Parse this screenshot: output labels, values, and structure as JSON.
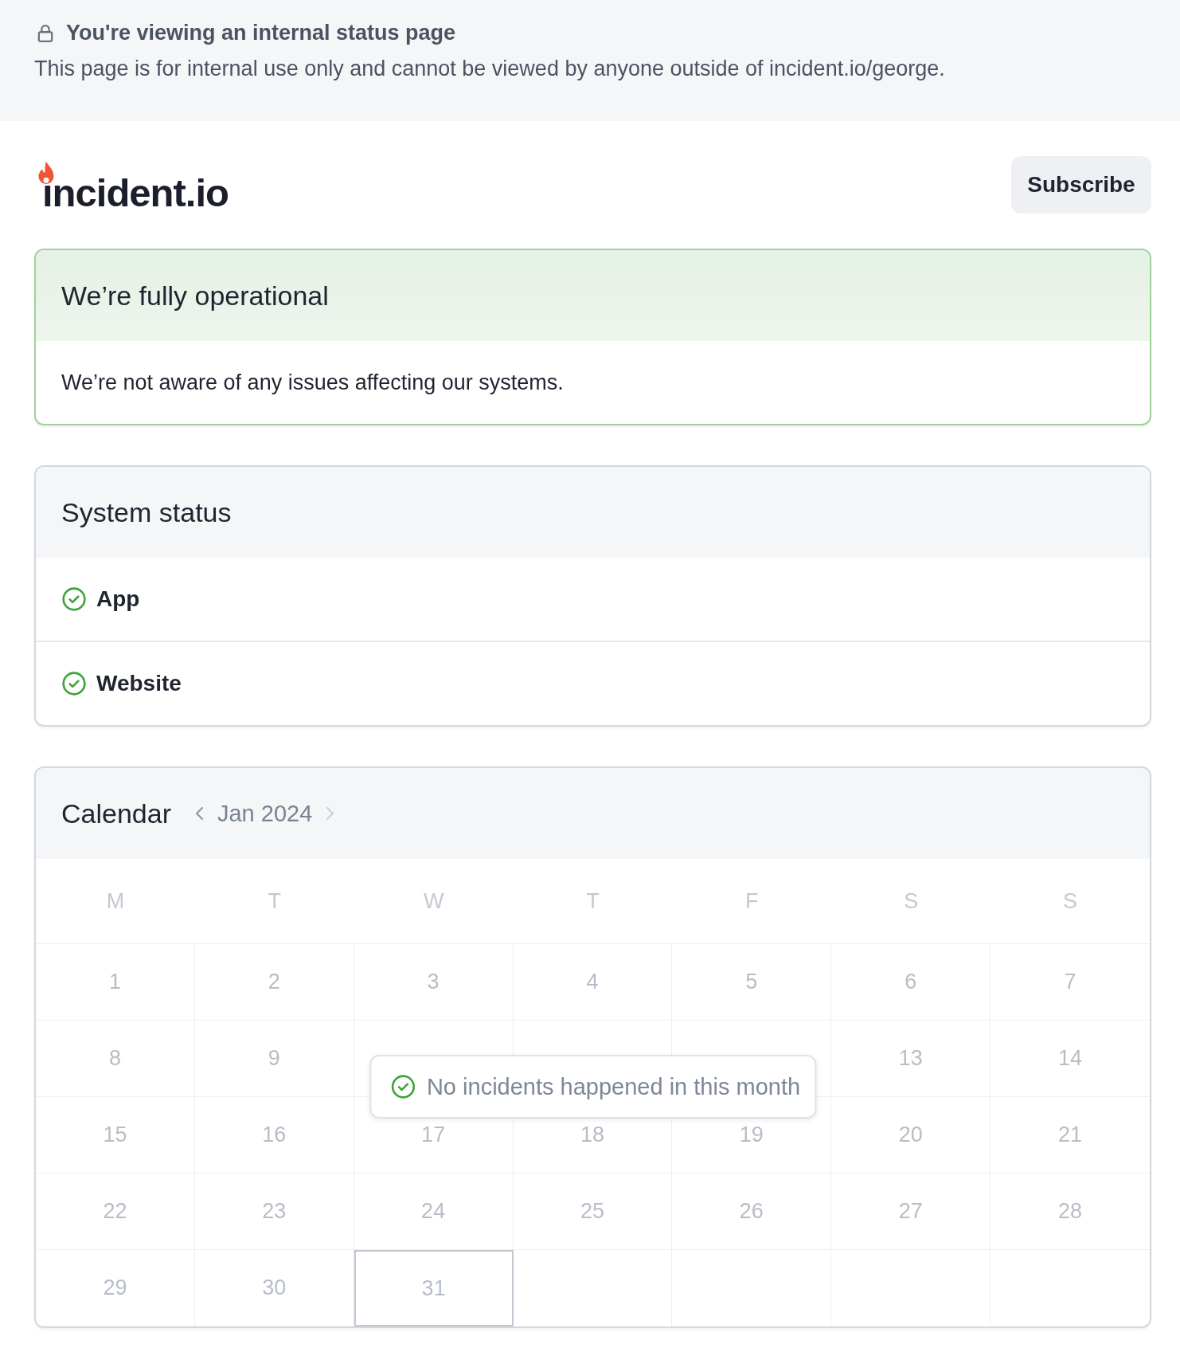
{
  "banner": {
    "title": "You're viewing an internal status page",
    "text": "This page is for internal use only and cannot be viewed by anyone outside of incident.io/george."
  },
  "header": {
    "logo": "incident.io",
    "subscribe_button": "Subscribe"
  },
  "summary": {
    "title": "We’re fully operational",
    "text": "We’re not aware of any issues affecting our systems."
  },
  "system_status": {
    "title": "System status",
    "components": [
      {
        "name": "App",
        "operational": true
      },
      {
        "name": "Website",
        "operational": true
      }
    ]
  },
  "calendar": {
    "title": "Calendar",
    "month": "Jan 2024",
    "weekdays": [
      "M",
      "T",
      "W",
      "T",
      "F",
      "S",
      "S"
    ],
    "days": [
      {
        "label": "1",
        "selected": false
      },
      {
        "label": "2",
        "selected": false
      },
      {
        "label": "3",
        "selected": false
      },
      {
        "label": "4",
        "selected": false
      },
      {
        "label": "5",
        "selected": false
      },
      {
        "label": "6",
        "selected": false
      },
      {
        "label": "7",
        "selected": false
      },
      {
        "label": "8",
        "selected": false
      },
      {
        "label": "9",
        "selected": false
      },
      {
        "selected": false
      },
      {
        "selected": false
      },
      {
        "selected": false
      },
      {
        "label": "13",
        "selected": false
      },
      {
        "label": "14",
        "selected": false
      },
      {
        "label": "15",
        "selected": false
      },
      {
        "label": "16",
        "selected": false
      },
      {
        "label": "17",
        "selected": false
      },
      {
        "label": "18",
        "selected": false
      },
      {
        "label": "19",
        "selected": false
      },
      {
        "label": "20",
        "selected": false
      },
      {
        "label": "21",
        "selected": false
      },
      {
        "label": "22",
        "selected": false
      },
      {
        "label": "23",
        "selected": false
      },
      {
        "label": "24",
        "selected": false
      },
      {
        "label": "25",
        "selected": false
      },
      {
        "label": "26",
        "selected": false
      },
      {
        "label": "27",
        "selected": false
      },
      {
        "label": "28",
        "selected": false
      },
      {
        "label": "29",
        "selected": false
      },
      {
        "label": "30",
        "selected": false
      },
      {
        "label": "31",
        "selected": true
      }
    ],
    "notice": "No incidents happened in this month"
  }
}
